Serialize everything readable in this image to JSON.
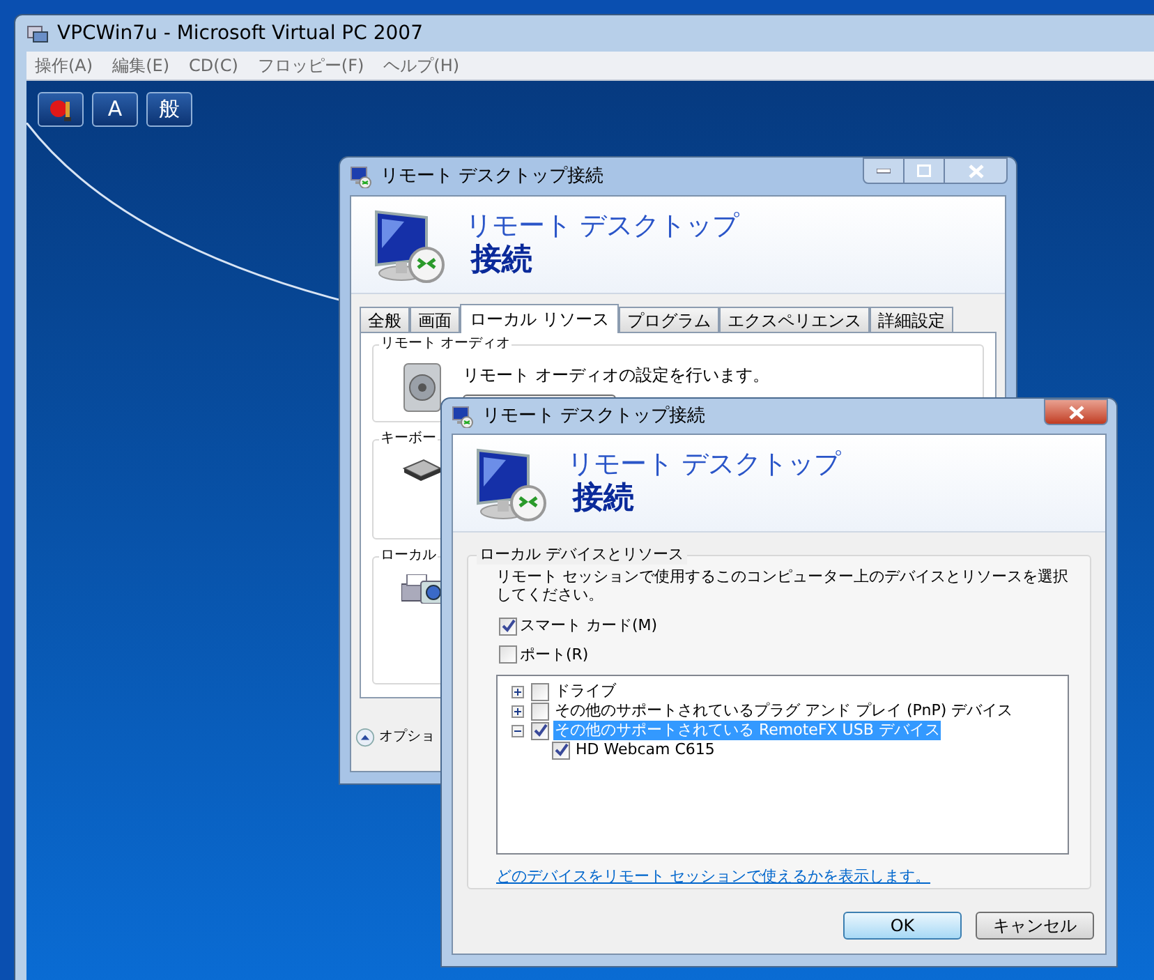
{
  "host_window": {
    "title": "VPCWin7u - Microsoft Virtual PC 2007",
    "menu": [
      {
        "label": "操作(A)"
      },
      {
        "label": "編集(E)"
      },
      {
        "label": "CD(C)"
      },
      {
        "label": "フロッピー(F)"
      },
      {
        "label": "ヘルプ(H)"
      }
    ],
    "toolbar": [
      {
        "kind": "icon"
      },
      {
        "kind": "text",
        "label": "A"
      },
      {
        "kind": "text",
        "label": "般"
      }
    ]
  },
  "back_dialog": {
    "title": "リモート デスクトップ接続",
    "banner": {
      "line1": "リモート デスクトップ",
      "line2": "接続"
    },
    "tabs": [
      {
        "label": "全般",
        "selected": false
      },
      {
        "label": "画面",
        "selected": false
      },
      {
        "label": "ローカル リソース",
        "selected": true
      },
      {
        "label": "プログラム",
        "selected": false
      },
      {
        "label": "エクスペリエンス",
        "selected": false
      },
      {
        "label": "詳細設定",
        "selected": false
      }
    ],
    "groups": [
      {
        "kind": "audio",
        "title": "リモート オーディオ",
        "text": "リモート オーディオの設定を行います。"
      },
      {
        "kind": "keyboard",
        "title": "キーボー"
      },
      {
        "kind": "printer",
        "title": "ローカル"
      }
    ],
    "options_label": "オプショ"
  },
  "front_dialog": {
    "title": "リモート デスクトップ接続",
    "banner": {
      "line1": "リモート デスクトップ",
      "line2": "接続"
    },
    "group_title": "ローカル デバイスとリソース",
    "description": "リモート セッションで使用するこのコンピューター上のデバイスとリソースを選択してください。",
    "checkboxes": [
      {
        "label": "スマート カード(M)",
        "checked": true
      },
      {
        "label": "ポート(R)",
        "checked": false
      }
    ],
    "tree": [
      {
        "label": "ドライブ",
        "checked": false,
        "expanded": false,
        "selected": false
      },
      {
        "label": "その他のサポートされているプラグ アンド プレイ (PnP) デバイス",
        "checked": false,
        "expanded": false,
        "selected": false
      },
      {
        "label": "その他のサポートされている RemoteFX USB デバイス",
        "checked": true,
        "expanded": true,
        "selected": true,
        "children": [
          {
            "label": "HD Webcam C615",
            "checked": true,
            "selected": false
          }
        ]
      }
    ],
    "link": "どのデバイスをリモート セッションで使えるかを表示します。",
    "buttons": [
      {
        "label": "OK",
        "default": true
      },
      {
        "label": "キャンセル",
        "default": false
      }
    ]
  }
}
